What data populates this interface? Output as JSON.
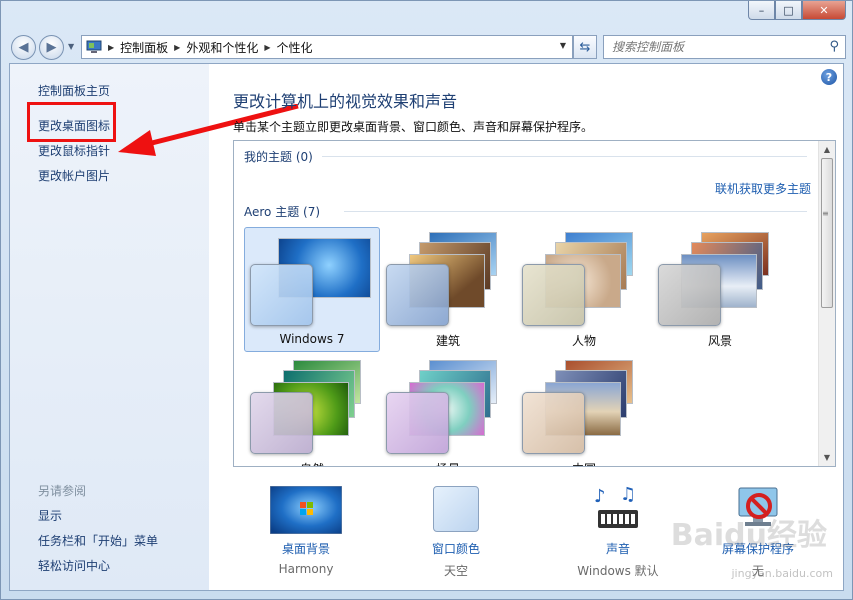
{
  "window": {
    "minimize": "–",
    "maximize": "□",
    "close": "✕"
  },
  "address": {
    "segments": [
      "控制面板",
      "外观和个性化",
      "个性化"
    ],
    "search_placeholder": "搜索控制面板"
  },
  "sidebar": {
    "links": [
      "控制面板主页",
      "更改桌面图标",
      "更改鼠标指针",
      "更改帐户图片"
    ],
    "see_also_heading": "另请参阅",
    "see_also": [
      "显示",
      "任务栏和「开始」菜单",
      "轻松访问中心"
    ]
  },
  "main": {
    "title": "更改计算机上的视觉效果和声音",
    "subtitle": "单击某个主题立即更改桌面背景、窗口颜色、声音和屏幕保护程序。",
    "my_themes": "我的主题 (0)",
    "online_link": "联机获取更多主题",
    "aero_themes": "Aero 主题 (7)",
    "themes": [
      "Windows 7",
      "建筑",
      "人物",
      "风景",
      "自然",
      "场景",
      "中国"
    ]
  },
  "bottom": [
    {
      "label": "桌面背景",
      "value": "Harmony"
    },
    {
      "label": "窗口颜色",
      "value": "天空"
    },
    {
      "label": "声音",
      "value": "Windows 默认"
    },
    {
      "label": "屏幕保护程序",
      "value": "无"
    }
  ],
  "watermark": {
    "logo": "Baidu经验",
    "url": "jingyan.baidu.com"
  },
  "colors": {
    "link": "#1e3f73",
    "annotation": "#ee1111",
    "selected": "#dbe9fa"
  }
}
